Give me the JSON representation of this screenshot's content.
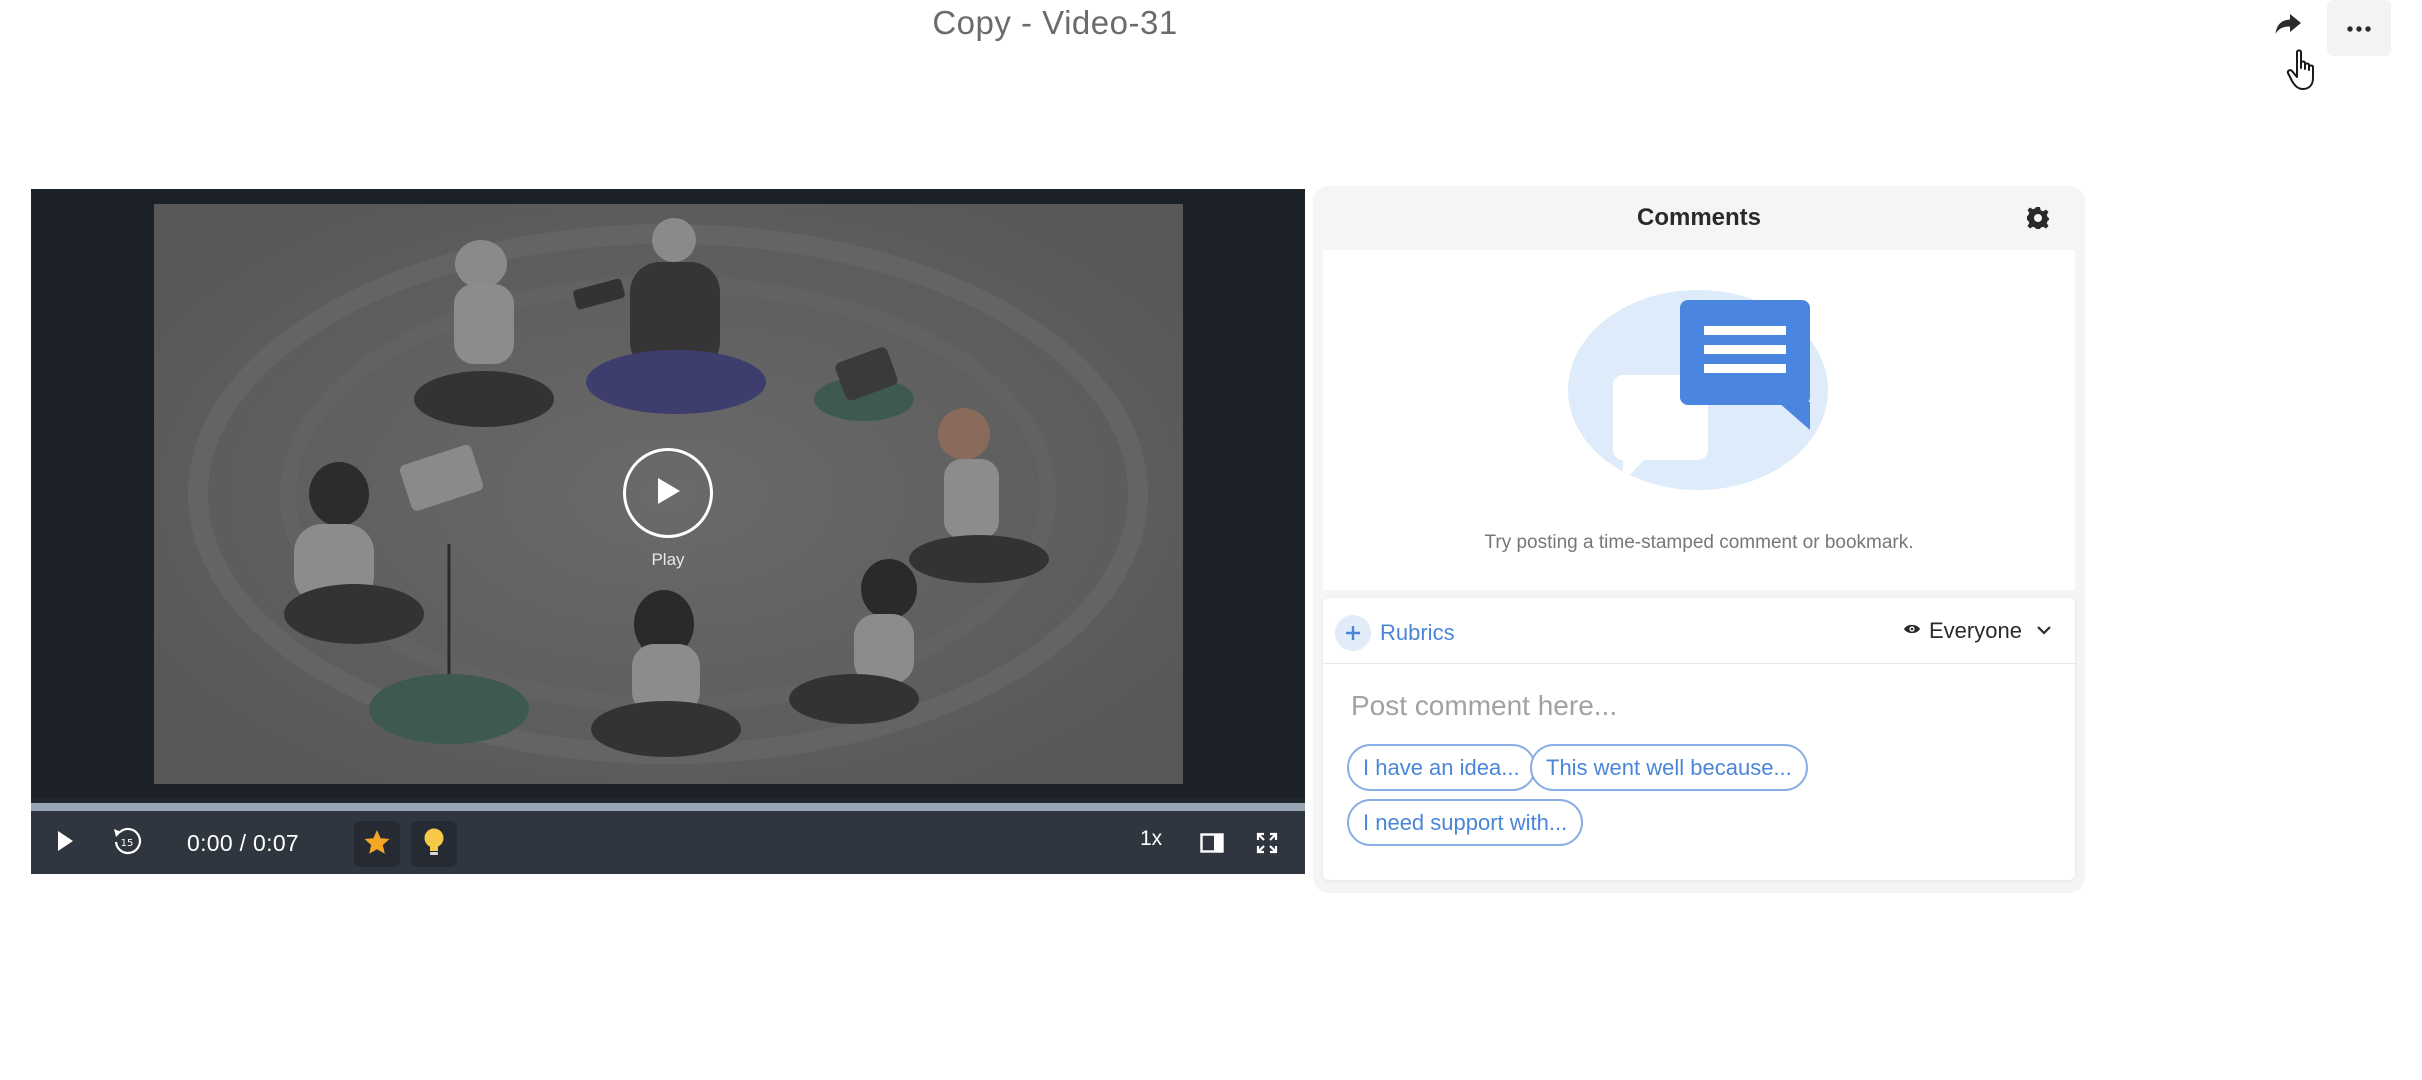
{
  "header": {
    "title": "Copy - Video-31",
    "share_icon": "share-arrow-icon",
    "more_icon": "more-dots-icon"
  },
  "player": {
    "play_label": "Play",
    "time_display": "0:00 / 0:07",
    "speed": "1x",
    "progress": 0,
    "icons": {
      "play": "play-icon",
      "rewind": "rewind-15-icon",
      "bookmark_star": "star-icon",
      "idea": "lightbulb-icon",
      "layout": "split-view-icon",
      "fullscreen": "fullscreen-icon"
    },
    "colors": {
      "star": "#f5a623",
      "bulb": "#f7c948"
    }
  },
  "comments": {
    "title": "Comments",
    "empty_message": "Try posting a time-stamped comment or bookmark.",
    "rubrics_label": "Rubrics",
    "audience_label": "Everyone",
    "placeholder": "Post comment here...",
    "prompts": [
      "I have an idea...",
      "This went well because...",
      "I need support with..."
    ],
    "accent_color": "#4a86d8"
  }
}
